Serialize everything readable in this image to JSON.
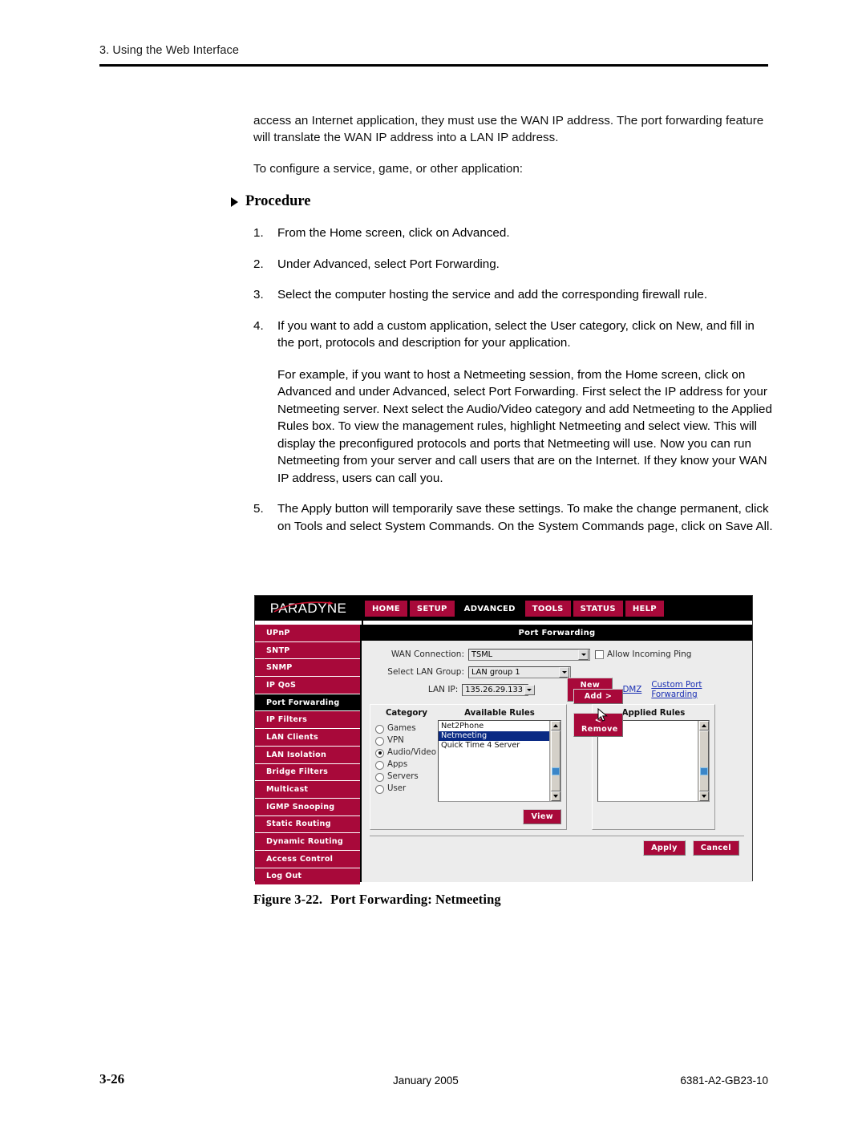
{
  "page": {
    "running_head": "3. Using the Web Interface",
    "paragraphs": [
      "access an Internet application, they must use the WAN IP address. The port forwarding feature will translate the WAN IP address into a LAN IP address.",
      "To configure a service, game, or other application:"
    ],
    "procedure_heading": "Procedure",
    "steps": [
      {
        "num": "1.",
        "text": "From the Home screen, click on Advanced."
      },
      {
        "num": "2.",
        "text": "Under Advanced, select Port Forwarding."
      },
      {
        "num": "3.",
        "text": "Select the computer hosting the service and add the corresponding firewall rule."
      },
      {
        "num": "4.",
        "text": "If you want to add a custom application, select the User category, click on New, and fill in the port, protocols and description for your application."
      }
    ],
    "example_paragraph": "For example, if you want to host a Netmeeting session, from the Home screen, click on Advanced and under Advanced, select Port Forwarding. First select the IP address for your Netmeeting server. Next select the Audio/Video category and add Netmeeting to the Applied Rules box. To view the management rules, highlight Netmeeting and select view. This will display the preconfigured protocols and ports that Netmeeting will use.  Now you can run Netmeeting from your server and call users that are on the Internet. If they know your WAN IP address, users can call you.",
    "step5": {
      "num": "5.",
      "text": "The Apply button will temporarily save these settings. To make the change permanent, click on Tools and select System Commands. On the System Commands page, click on Save All."
    },
    "figure_caption": {
      "label": "Figure 3-22.",
      "title": "Port Forwarding: Netmeeting"
    },
    "footer": {
      "page_number": "3-26",
      "date": "January 2005",
      "doc_number": "6381-A2-GB23-10"
    }
  },
  "screenshot": {
    "brand": "PARADYNE",
    "nav_tabs": [
      {
        "label": "HOME",
        "active": false
      },
      {
        "label": "SETUP",
        "active": false
      },
      {
        "label": "ADVANCED",
        "active": true
      },
      {
        "label": "TOOLS",
        "active": false
      },
      {
        "label": "STATUS",
        "active": false
      },
      {
        "label": "HELP",
        "active": false
      }
    ],
    "sidebar": [
      {
        "label": "UPnP",
        "active": false
      },
      {
        "label": "SNTP",
        "active": false
      },
      {
        "label": "SNMP",
        "active": false
      },
      {
        "label": "IP QoS",
        "active": false
      },
      {
        "label": "Port Forwarding",
        "active": true
      },
      {
        "label": "IP Filters",
        "active": false
      },
      {
        "label": "LAN Clients",
        "active": false
      },
      {
        "label": "LAN Isolation",
        "active": false
      },
      {
        "label": "Bridge Filters",
        "active": false
      },
      {
        "label": "Multicast",
        "active": false
      },
      {
        "label": "IGMP Snooping",
        "active": false
      },
      {
        "label": "Static Routing",
        "active": false
      },
      {
        "label": "Dynamic Routing",
        "active": false
      },
      {
        "label": "Access Control",
        "active": false
      },
      {
        "label": "Log Out",
        "active": false
      }
    ],
    "pane_title": "Port Forwarding",
    "form": {
      "wan_connection_label": "WAN Connection:",
      "wan_connection_value": "TSML",
      "allow_ping_label": "Allow Incoming Ping",
      "allow_ping_checked": false,
      "lan_group_label": "Select LAN Group:",
      "lan_group_value": "LAN group 1",
      "lan_ip_label": "LAN IP:",
      "lan_ip_value": "135.26.29.133",
      "new_ip_button": "New IP",
      "dmz_link": "DMZ",
      "custom_pf_link": "Custom Port Forwarding"
    },
    "category_header": "Category",
    "available_rules_header": "Available Rules",
    "applied_rules_header": "Applied Rules",
    "categories": [
      {
        "label": "Games",
        "selected": false
      },
      {
        "label": "VPN",
        "selected": false
      },
      {
        "label": "Audio/Video",
        "selected": true
      },
      {
        "label": "Apps",
        "selected": false
      },
      {
        "label": "Servers",
        "selected": false
      },
      {
        "label": "User",
        "selected": false
      }
    ],
    "available_rules": [
      {
        "label": "Net2Phone",
        "selected": false
      },
      {
        "label": "Netmeeting",
        "selected": true
      },
      {
        "label": "Quick Time 4 Server",
        "selected": false
      }
    ],
    "applied_rules": [],
    "buttons": {
      "view": "View",
      "add": "Add >",
      "remove": "< Remove",
      "apply": "Apply",
      "cancel": "Cancel"
    },
    "colors": {
      "brand_red": "#a8093a",
      "active_black": "#000000",
      "link_blue": "#1a2fb4",
      "selection_blue": "#0a2a84",
      "chrome_gray": "#ececec"
    }
  }
}
